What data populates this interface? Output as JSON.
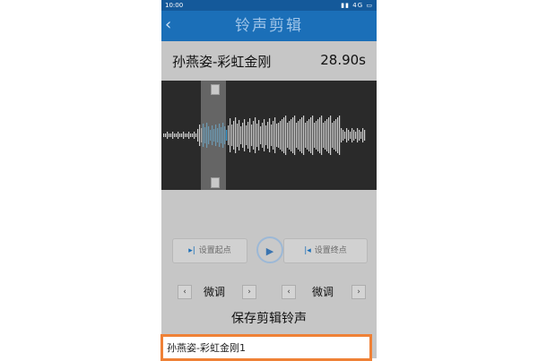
{
  "status_bar": {
    "time": "10:00",
    "network": "4G"
  },
  "header": {
    "back_icon": "back-arrow-icon",
    "title": "铃声剪辑"
  },
  "song": {
    "name": "孙燕姿-彩虹金刚",
    "duration": "28.90s"
  },
  "controls": {
    "set_start_label": "设置起点",
    "set_end_label": "设置终点",
    "play_icon": "play-icon"
  },
  "fine_tune": {
    "left_label": "微调",
    "right_label": "微调",
    "prev_arrow": "‹",
    "next_arrow": "›"
  },
  "save_dialog": {
    "title": "保存剪辑铃声",
    "filename_value": "孙燕姿-彩虹金刚1"
  },
  "colors": {
    "accent": "#1b6fb8",
    "highlight_border": "#ef8136",
    "waveform": "#d0d0d0",
    "waveform_selected": "#3a9fd8"
  }
}
